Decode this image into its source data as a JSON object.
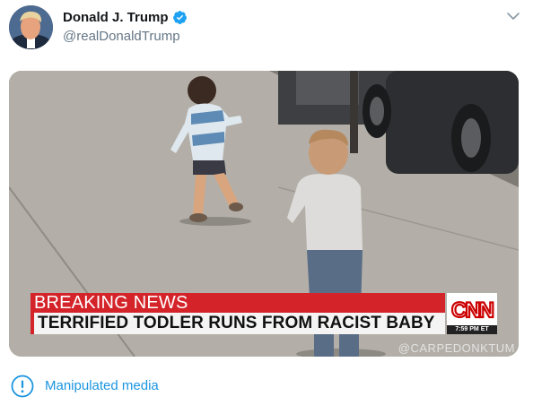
{
  "tweet": {
    "display_name": "Donald J. Trump",
    "handle": "@realDonaldTrump",
    "verified": true,
    "menu_icon": "chevron-down-icon"
  },
  "media": {
    "chyron_headline": "BREAKING NEWS",
    "chyron_text": "TERRIFIED TODLER RUNS FROM RACIST BABY",
    "network_logo": "CNN",
    "network_time": "7:59 PM ET",
    "watermark": "@CARPEDONKTUM"
  },
  "notice": {
    "icon": "exclamation-circle-icon",
    "label": "Manipulated media"
  },
  "colors": {
    "accent": "#1b95e0",
    "verified": "#1da1f2",
    "chyron_red": "#d4242a",
    "muted_text": "#657786"
  }
}
